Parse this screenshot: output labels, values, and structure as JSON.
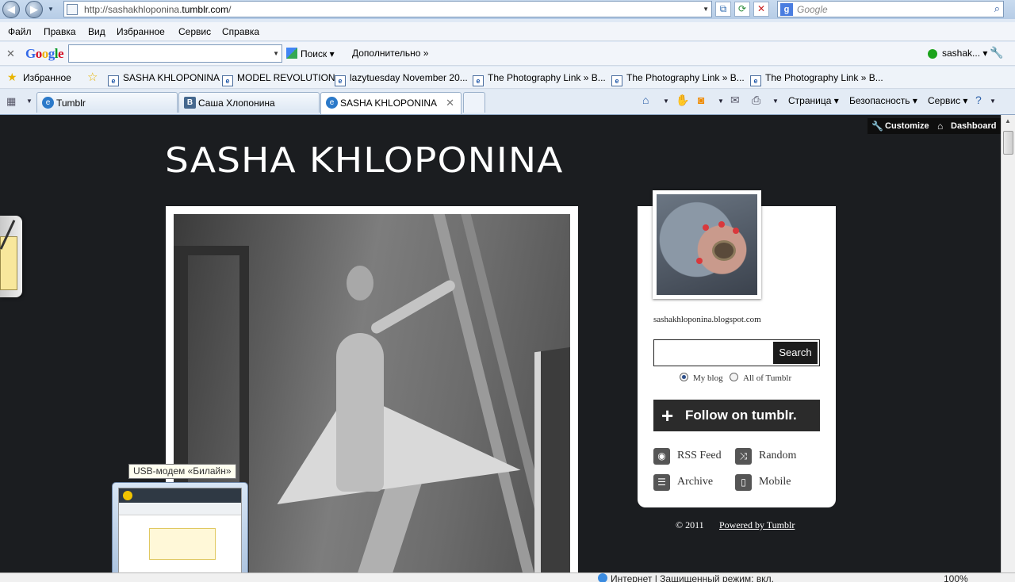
{
  "address_bar": {
    "url_prefix": "http://sashakhloponina.",
    "url_domain": "tumblr.com",
    "url_suffix": "/",
    "search_placeholder": "Google"
  },
  "menu": [
    "Файл",
    "Правка",
    "Вид",
    "Избранное",
    "Сервис",
    "Справка"
  ],
  "google_toolbar": {
    "logo": "Google",
    "search_button": "Поиск",
    "more": "Дополнительно »",
    "user": "sashak..."
  },
  "favorites": {
    "label": "Избранное",
    "links": [
      "SASHA KHLOPONINA",
      "MODEL REVOLUTION",
      "lazytuesday November 20...",
      "The Photography Link » B...",
      "The Photography Link » B...",
      "The Photography Link » B..."
    ]
  },
  "tabs": [
    {
      "label": "Tumblr",
      "icon": "ie-icon"
    },
    {
      "label": "Саша Хлопонина",
      "icon": "vk-icon"
    },
    {
      "label": "SASHA KHLOPONINA",
      "icon": "ie-icon"
    }
  ],
  "commands": {
    "page": "Страница",
    "safety": "Безопасность",
    "tools": "Сервис"
  },
  "tumblr_controls": {
    "customize": "Customize",
    "dashboard": "Dashboard"
  },
  "blog": {
    "title": "SASHA KHLOPONINA",
    "sidebar_link": "sashakhloponina.blogspot.com",
    "search_button": "Search",
    "radio_my_blog": "My blog",
    "radio_all": "All of Tumblr",
    "follow": "Follow on tumblr.",
    "nav": {
      "rss": "RSS Feed",
      "random": "Random",
      "archive": "Archive",
      "mobile": "Mobile"
    },
    "footer_copy": "© 2011",
    "footer_powered": "Powered by Tumblr"
  },
  "taskbar_tooltip": "USB-модем «Билайн»",
  "status": {
    "zone": "Интернет | Защищенный режим: вкл.",
    "zoom": "100%"
  },
  "colors": {
    "page_background": "#1b1d20",
    "ie_chrome": "#dfe9f5"
  }
}
